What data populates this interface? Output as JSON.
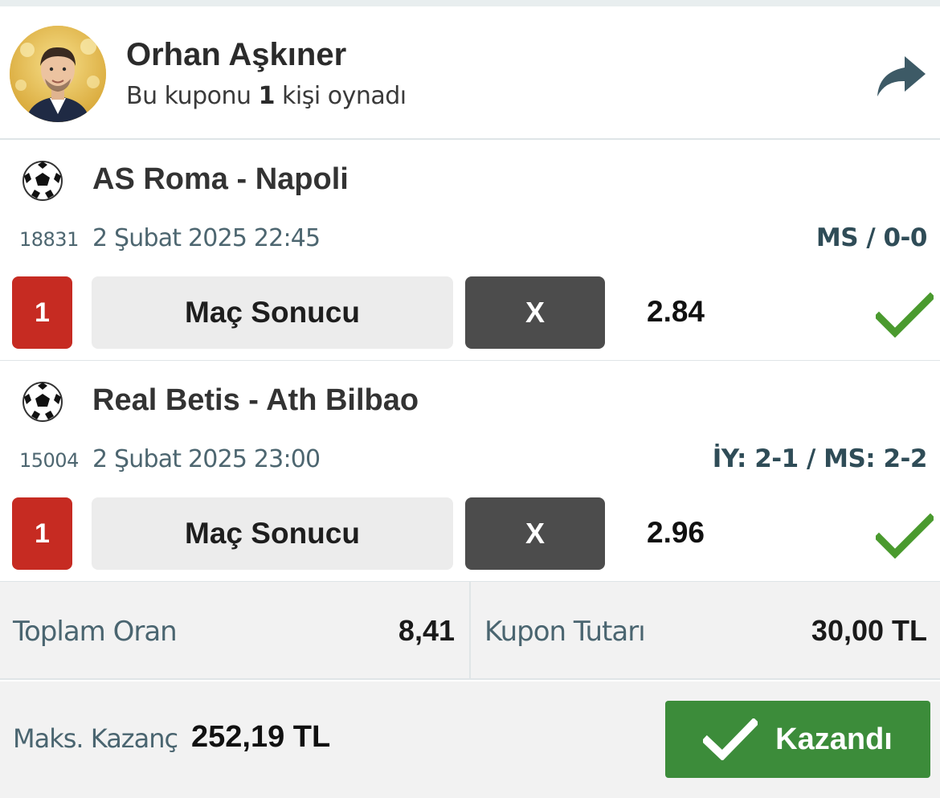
{
  "header": {
    "user_name": "Orhan Aşkıner",
    "played_prefix": "Bu kuponu",
    "played_count": "1",
    "played_suffix": "kişi oynadı"
  },
  "matches": [
    {
      "teams": "AS Roma - Napoli",
      "code": "18831",
      "datetime": "2 Şubat 2025 22:45",
      "result": "MS / 0-0",
      "bet_number": "1",
      "market": "Maç Sonucu",
      "pick": "X",
      "odd": "2.84",
      "status_icon": "check-icon"
    },
    {
      "teams": "Real Betis - Ath Bilbao",
      "code": "15004",
      "datetime": "2 Şubat 2025 23:00",
      "result": "İY: 2-1 / MS: 2-2",
      "bet_number": "1",
      "market": "Maç Sonucu",
      "pick": "X",
      "odd": "2.96",
      "status_icon": "check-icon"
    }
  ],
  "totals": {
    "total_odds_label": "Toplam Oran",
    "total_odds_value": "8,41",
    "stake_label": "Kupon Tutarı",
    "stake_value": "30,00 TL"
  },
  "footer": {
    "max_win_label": "Maks. Kazanç",
    "max_win_value": "252,19 TL",
    "status_button": "Kazandı"
  },
  "colors": {
    "badge_red": "#c62b22",
    "pick_dark": "#4c4c4c",
    "success_green": "#3c8c3a",
    "check_green": "#4a9a2e",
    "label_slate": "#4a6570"
  }
}
